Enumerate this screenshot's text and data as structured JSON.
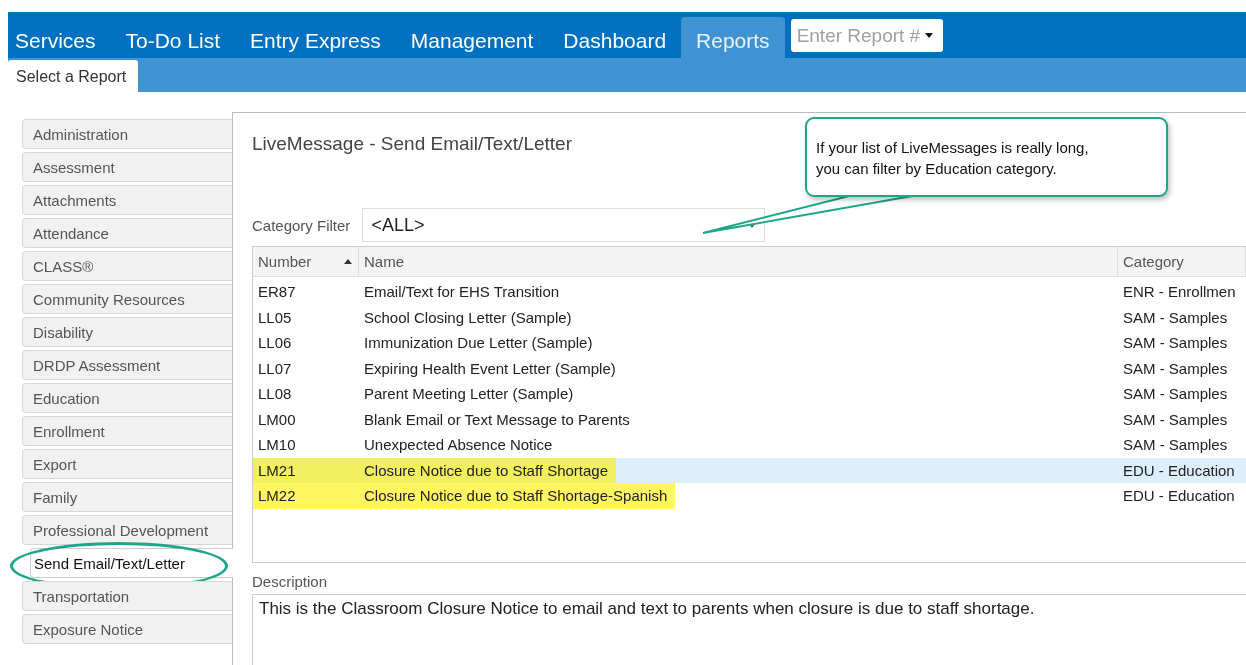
{
  "nav": {
    "tabs": [
      {
        "label": "Services",
        "selected": false
      },
      {
        "label": "To-Do List",
        "selected": false
      },
      {
        "label": "Entry Express",
        "selected": false
      },
      {
        "label": "Management",
        "selected": false
      },
      {
        "label": "Dashboard",
        "selected": false
      },
      {
        "label": "Reports",
        "selected": true
      }
    ],
    "report_field": {
      "placeholder": "Enter Report #"
    }
  },
  "subnav": {
    "tabs": [
      {
        "label": "Select a Report",
        "selected": true
      }
    ]
  },
  "sidebar": {
    "items": [
      {
        "label": "Administration",
        "selected": false
      },
      {
        "label": "Assessment",
        "selected": false
      },
      {
        "label": "Attachments",
        "selected": false
      },
      {
        "label": "Attendance",
        "selected": false
      },
      {
        "label": "CLASS®",
        "selected": false
      },
      {
        "label": "Community Resources",
        "selected": false
      },
      {
        "label": "Disability",
        "selected": false
      },
      {
        "label": "DRDP Assessment",
        "selected": false
      },
      {
        "label": "Education",
        "selected": false
      },
      {
        "label": "Enrollment",
        "selected": false
      },
      {
        "label": "Export",
        "selected": false
      },
      {
        "label": "Family",
        "selected": false
      },
      {
        "label": "Professional Development",
        "selected": false
      },
      {
        "label": "Send Email/Text/Letter",
        "selected": true
      },
      {
        "label": "Transportation",
        "selected": false
      },
      {
        "label": "Exposure Notice",
        "selected": false
      }
    ]
  },
  "panel": {
    "title": "LiveMessage - Send Email/Text/Letter",
    "filter": {
      "label": "Category Filter",
      "value": "<ALL>"
    },
    "table": {
      "columns": [
        {
          "label": "Number",
          "sorted": true
        },
        {
          "label": "Name",
          "sorted": false
        },
        {
          "label": "Category",
          "sorted": false
        }
      ],
      "rows": [
        {
          "cells": [
            "ER87",
            "Email/Text for EHS Transition",
            "ENR - Enrollmen"
          ],
          "selected": false,
          "highlighted": false
        },
        {
          "cells": [
            "LL05",
            "School Closing Letter (Sample)",
            "SAM - Samples"
          ],
          "selected": false,
          "highlighted": false
        },
        {
          "cells": [
            "LL06",
            "Immunization Due Letter (Sample)",
            "SAM - Samples"
          ],
          "selected": false,
          "highlighted": false
        },
        {
          "cells": [
            "LL07",
            "Expiring Health Event Letter (Sample)",
            "SAM - Samples"
          ],
          "selected": false,
          "highlighted": false
        },
        {
          "cells": [
            "LL08",
            "Parent Meeting Letter (Sample)",
            "SAM - Samples"
          ],
          "selected": false,
          "highlighted": false
        },
        {
          "cells": [
            "LM00",
            "Blank Email or Text Message to Parents",
            "SAM - Samples"
          ],
          "selected": false,
          "highlighted": false
        },
        {
          "cells": [
            "LM10",
            "Unexpected Absence Notice",
            "SAM - Samples"
          ],
          "selected": false,
          "highlighted": false
        },
        {
          "cells": [
            "LM21",
            "Closure Notice due to Staff Shortage",
            "EDU - Education"
          ],
          "selected": true,
          "highlighted": true
        },
        {
          "cells": [
            "LM22",
            "Closure Notice due to Staff Shortage-Spanish",
            "EDU - Education"
          ],
          "selected": false,
          "highlighted": true
        }
      ]
    },
    "description": {
      "label": "Description",
      "value": "This is the Classroom Closure Notice to email and text to parents when closure is due to staff shortage."
    }
  },
  "callout": {
    "lines": [
      "If your list of LiveMessages is really long,",
      "you can filter by Education category."
    ]
  }
}
